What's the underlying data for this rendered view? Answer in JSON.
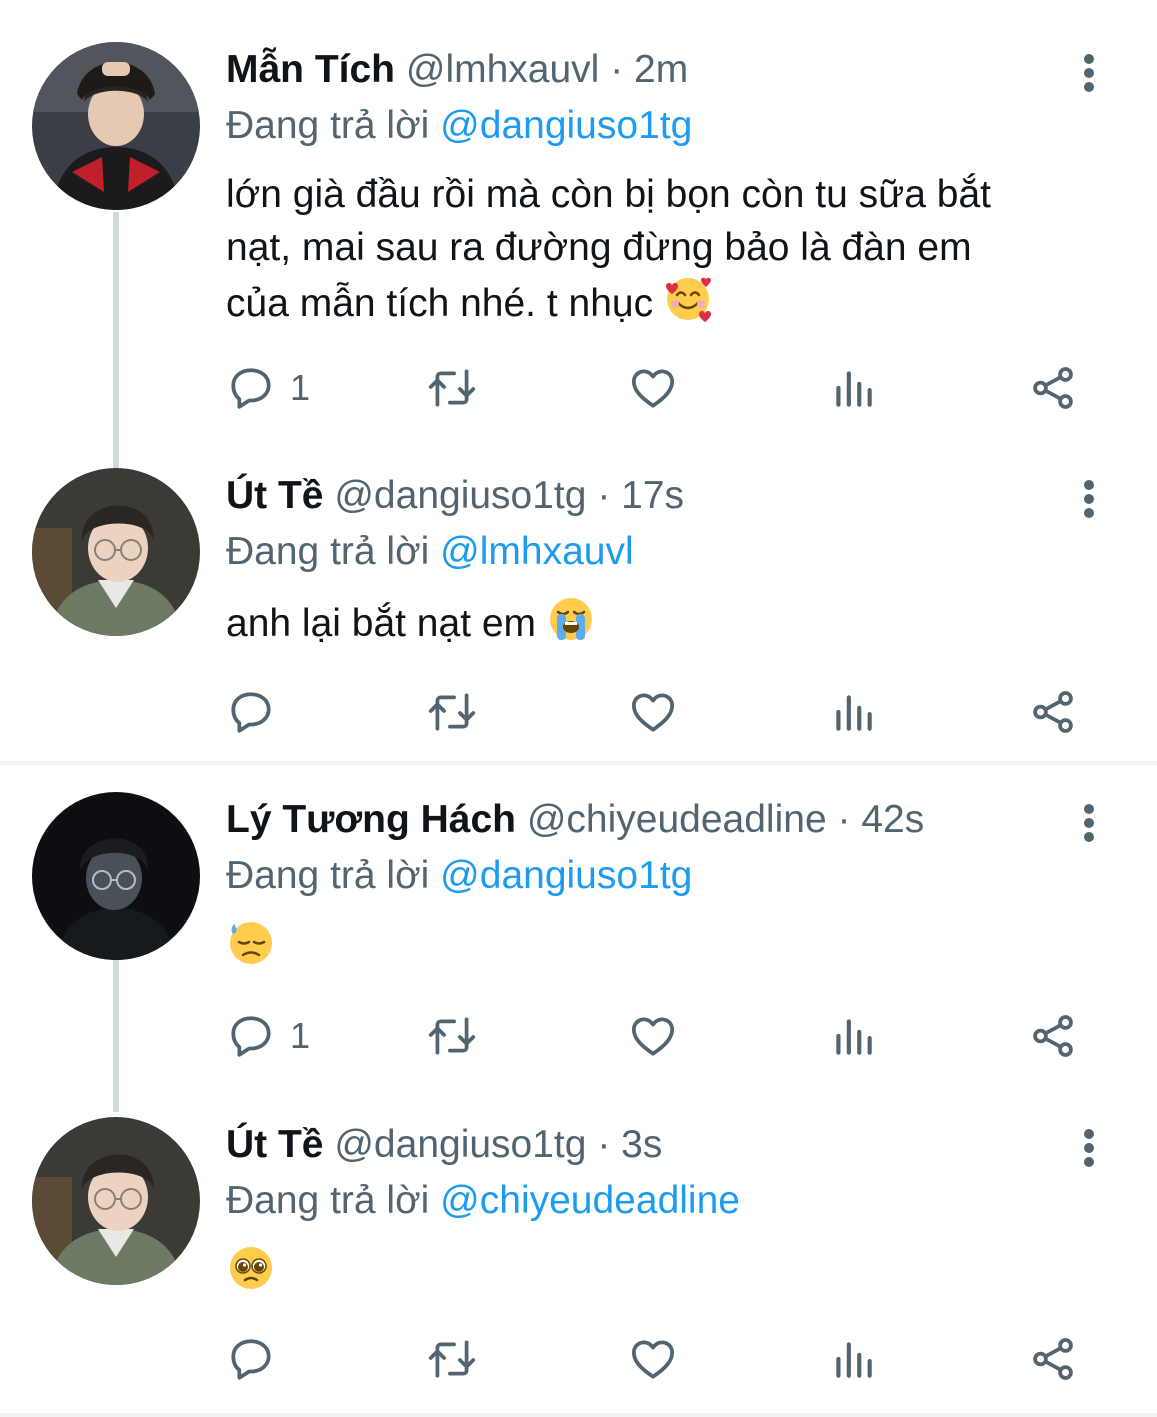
{
  "threads": [
    {
      "tweets": [
        {
          "display_name": "Mẫn Tích",
          "handle": "@lmhxauvl",
          "dot": "·",
          "time": "2m",
          "replying_prefix": "Đang trả lời",
          "replying_to": "@dangiuso1tg",
          "text_line1": "lớn già đầu rồi mà còn bị bọn còn tu sữa bắt",
          "text_line2": "nạt, mai sau ra đường đừng bảo là đàn em",
          "text_line3": "của mẫn tích nhé. t nhục",
          "emoji": "smiling-face-with-hearts",
          "reply_count": "1"
        },
        {
          "display_name": "Út Tề",
          "handle": "@dangiuso1tg",
          "dot": "·",
          "time": "17s",
          "replying_prefix": "Đang trả lời",
          "replying_to": "@lmhxauvl",
          "text_line1": "anh lại bắt nạt em",
          "emoji": "loudly-crying-face",
          "reply_count": ""
        }
      ]
    },
    {
      "tweets": [
        {
          "display_name": "Lý Tương Hách",
          "handle": "@chiyeudeadline",
          "dot": "·",
          "time": "42s",
          "replying_prefix": "Đang trả lời",
          "replying_to": "@dangiuso1tg",
          "text_line1": "",
          "emoji": "downcast-face-with-sweat",
          "reply_count": "1"
        },
        {
          "display_name": "Út Tề",
          "handle": "@dangiuso1tg",
          "dot": "·",
          "time": "3s",
          "replying_prefix": "Đang trả lời",
          "replying_to": "@chiyeudeadline",
          "text_line1": "",
          "emoji": "pleading-face",
          "reply_count": ""
        }
      ]
    }
  ],
  "icons": {
    "reply": "reply-icon",
    "retweet": "retweet-icon",
    "like": "like-icon",
    "views": "views-icon",
    "share": "share-icon",
    "more": "more-icon"
  },
  "colors": {
    "text": "#0f1419",
    "secondary": "#536471",
    "link": "#1d9bf0",
    "connector": "#cfd9de",
    "separator": "#eff3f4"
  }
}
